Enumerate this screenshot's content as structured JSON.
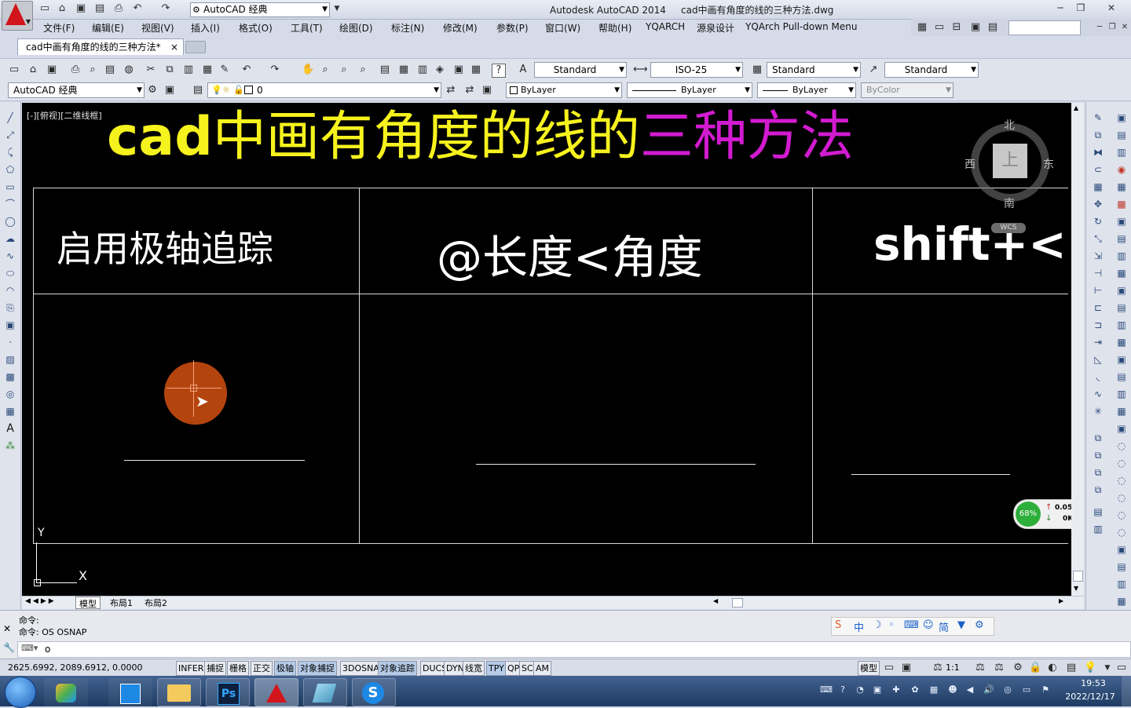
{
  "titlebar": {
    "workspace": "AutoCAD 经典",
    "title": "Autodesk AutoCAD 2014     cad中画有角度的线的三种方法.dwg"
  },
  "menus": [
    "文件(F)",
    "编辑(E)",
    "视图(V)",
    "插入(I)",
    "格式(O)",
    "工具(T)",
    "绘图(D)",
    "标注(N)",
    "修改(M)",
    "参数(P)",
    "窗口(W)",
    "帮助(H)",
    "YQARCH",
    "源泉设计",
    "YQArch Pull-down Menu"
  ],
  "doc_tab": {
    "label": "cad中画有角度的线的三种方法*",
    "close": "×"
  },
  "toolbar1": {
    "text_style": "Standard",
    "dim_style": "ISO-25",
    "table_style": "Standard",
    "mleader_style": "Standard"
  },
  "toolbar2": {
    "workspace": "AutoCAD 经典",
    "layer": "0",
    "color": "ByLayer",
    "linetype": "ByLayer",
    "lineweight": "ByLayer",
    "plotstyle": "ByColor"
  },
  "viewport_label": "[-][俯视][二维线框]",
  "drawing": {
    "title_part1": "cad",
    "title_part2": "中画有角度的线的",
    "title_part3": "三种方法",
    "col1": "启用极轴追踪",
    "col2": "@长度<角度",
    "col3": "shift+<",
    "colors": {
      "yellow": "#f6f21e",
      "magenta": "#d21bd0",
      "white": "#ffffff",
      "cursor_circle": "#b4440e"
    }
  },
  "viewcube": {
    "north": "北",
    "south": "南",
    "east": "东",
    "west": "西",
    "top": "上",
    "wcs": "WCS"
  },
  "ucs": {
    "y": "Y",
    "x": "X"
  },
  "netmeter": {
    "percent": "68%",
    "up": "0.05K/s",
    "down": "0K/s"
  },
  "layout_tabs": [
    "模型",
    "布局1",
    "布局2"
  ],
  "command": {
    "line1": "命令:",
    "line2": "命令: OS OSNAP",
    "input": "o"
  },
  "ime_bar": [
    "中",
    "简"
  ],
  "status": {
    "coords": "2625.6992, 2089.6912, 0.0000",
    "toggles": [
      "INFER",
      "捕捉",
      "栅格",
      "正交",
      "极轴",
      "对象捕捉",
      "3DOSNAP",
      "对象追踪",
      "DUCS",
      "DYN",
      "线宽",
      "TPY",
      "QP",
      "SC",
      "AM"
    ],
    "model": "模型",
    "scale": "1:1"
  },
  "clock": {
    "time": "19:53",
    "date": "2022/12/17"
  }
}
